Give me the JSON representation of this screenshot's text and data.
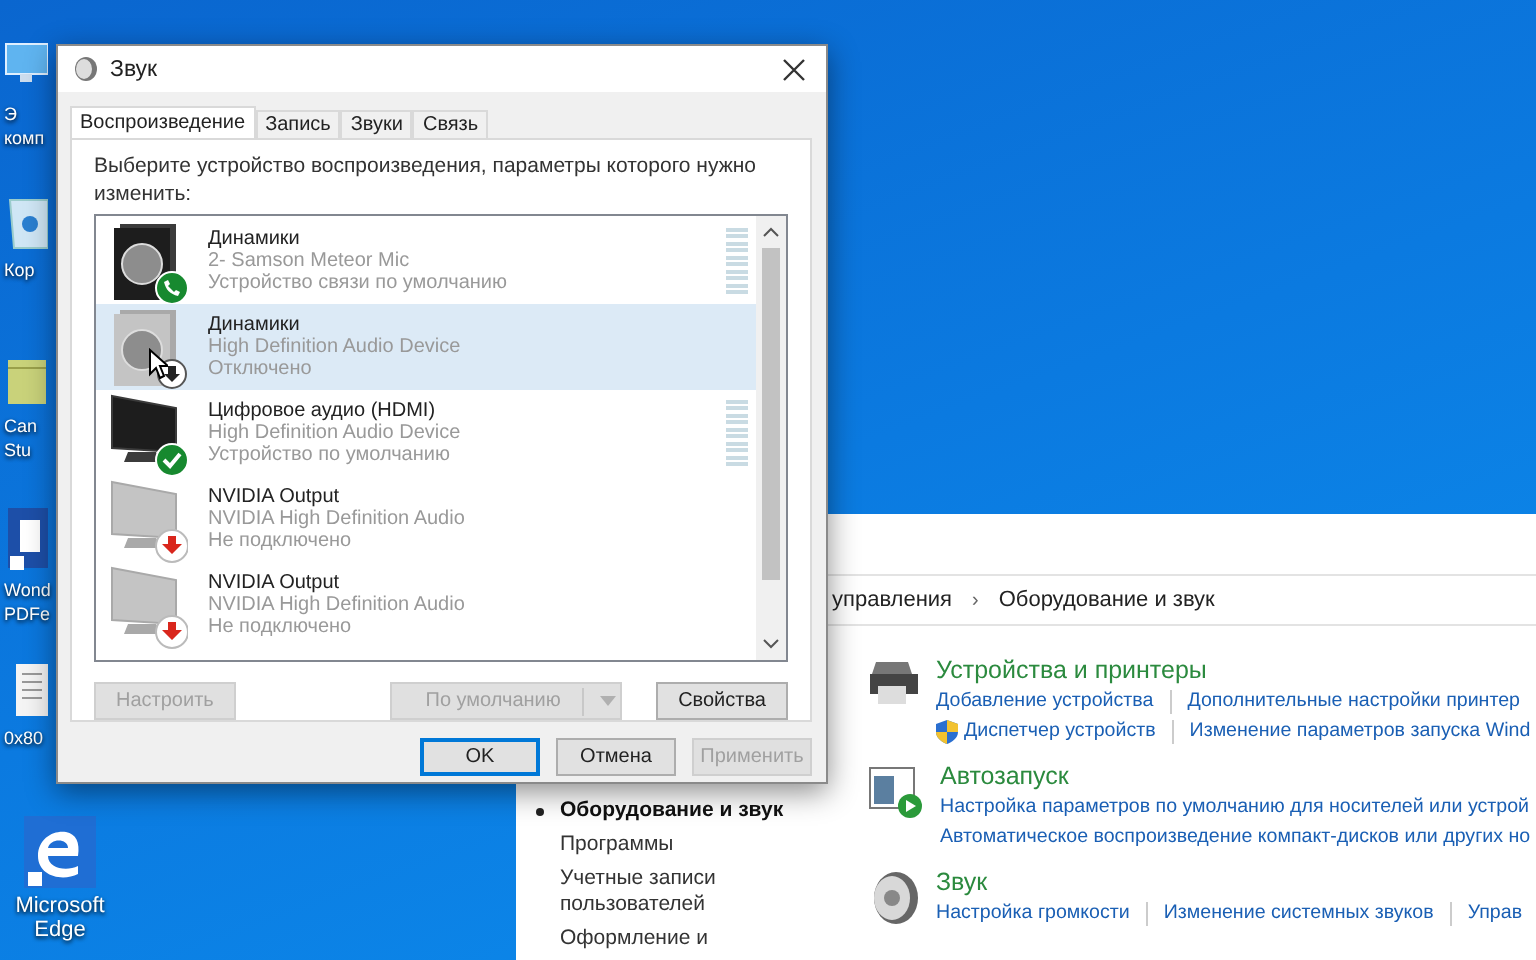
{
  "desktop_icons": [
    {
      "kind": "computer",
      "lines": [
        "Э",
        "комп"
      ]
    },
    {
      "kind": "recycle-bin",
      "lines": [
        "Кор"
      ]
    },
    {
      "kind": "folder",
      "lines": [
        "Can",
        "Stu"
      ]
    },
    {
      "kind": "app",
      "lines": [
        "Wond",
        "PDFe"
      ]
    },
    {
      "kind": "document",
      "lines": [
        "0x80"
      ]
    },
    {
      "kind": "edge",
      "lines": [
        "Microsoft",
        "Edge"
      ]
    }
  ],
  "control_panel": {
    "breadcrumb": [
      "управления",
      "Оборудование и звук"
    ],
    "breadcrumb_separator": "›",
    "sidebar": [
      {
        "label": "Оборудование и звук",
        "selected": true
      },
      {
        "label": "Программы",
        "selected": false
      },
      {
        "label": "Учетные записи пользователей",
        "selected": false
      },
      {
        "label": "Оформление и",
        "selected": false
      }
    ],
    "categories": [
      {
        "kind": "devices",
        "title": "Устройства и принтеры",
        "link_rows": [
          [
            {
              "label": "Добавление устройства",
              "shield": false
            },
            {
              "label": "Дополнительные настройки принтер",
              "shield": false
            }
          ],
          [
            {
              "label": "Диспетчер устройств",
              "shield": true
            },
            {
              "label": "Изменение параметров запуска Wind",
              "shield": false
            }
          ]
        ]
      },
      {
        "kind": "autoplay",
        "title": "Автозапуск",
        "link_rows": [
          [
            {
              "label": "Настройка параметров по умолчанию для носителей или устрой",
              "shield": false
            }
          ],
          [
            {
              "label": "Автоматическое воспроизведение компакт-дисков или других но",
              "shield": false
            }
          ]
        ]
      },
      {
        "kind": "sound",
        "title": "Звук",
        "link_rows": [
          [
            {
              "label": "Настройка громкости",
              "shield": false
            },
            {
              "label": "Изменение системных звуков",
              "shield": false
            },
            {
              "label": "Управ",
              "shield": false
            }
          ]
        ]
      }
    ]
  },
  "dialog": {
    "title": "Звук",
    "tabs": [
      {
        "label": "Воспроизведение",
        "selected": true
      },
      {
        "label": "Запись",
        "selected": false
      },
      {
        "label": "Звуки",
        "selected": false
      },
      {
        "label": "Связь",
        "selected": false
      }
    ],
    "instruction": "Выберите устройство воспроизведения, параметры которого нужно изменить:",
    "devices": [
      {
        "kind": "speaker",
        "name": "Динамики",
        "detail": "2- Samson Meteor Mic",
        "status": "Устройство связи по умолчанию",
        "badge": {
          "kind": "phone"
        },
        "active": true,
        "meter": true,
        "selected": false
      },
      {
        "kind": "speaker",
        "name": "Динамики",
        "detail": "High Definition Audio Device",
        "status": "Отключено",
        "badge": {
          "kind": "disabled"
        },
        "active": false,
        "meter": false,
        "selected": true
      },
      {
        "kind": "monitor",
        "name": "Цифровое аудио (HDMI)",
        "detail": "High Definition Audio Device",
        "status": "Устройство по умолчанию",
        "badge": {
          "kind": "check"
        },
        "active": true,
        "meter": true,
        "selected": false
      },
      {
        "kind": "monitor",
        "name": "NVIDIA Output",
        "detail": "NVIDIA High Definition Audio",
        "status": "Не подключено",
        "badge": {
          "kind": "unplugged"
        },
        "active": false,
        "meter": false,
        "selected": false
      },
      {
        "kind": "monitor",
        "name": "NVIDIA Output",
        "detail": "NVIDIA High Definition Audio",
        "status": "Не подключено",
        "badge": {
          "kind": "unplugged"
        },
        "active": false,
        "meter": false,
        "selected": false
      }
    ],
    "actions": [
      {
        "label": "Настроить",
        "disabled": true,
        "kind": "button"
      },
      {
        "label": "По умолчанию",
        "disabled": true,
        "kind": "split"
      },
      {
        "label": "Свойства",
        "disabled": false,
        "kind": "button"
      }
    ],
    "footer": [
      {
        "label": "OK",
        "disabled": false,
        "default": true
      },
      {
        "label": "Отмена",
        "disabled": false,
        "default": false
      },
      {
        "label": "Применить",
        "disabled": true,
        "default": false
      }
    ]
  }
}
